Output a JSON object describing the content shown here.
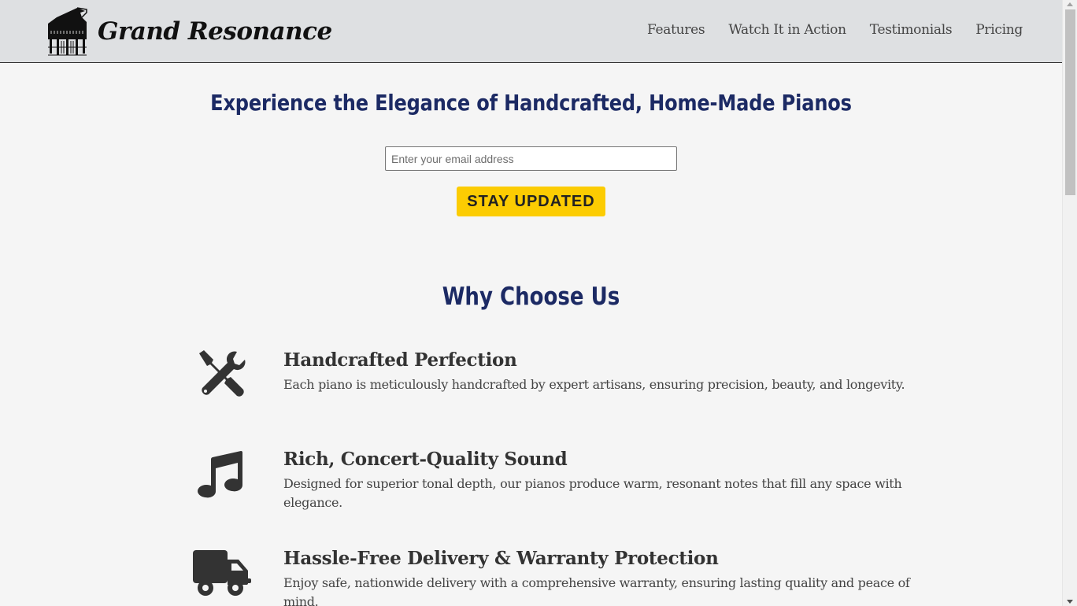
{
  "header": {
    "brand": "Grand Resonance",
    "nav": [
      {
        "label": "Features"
      },
      {
        "label": "Watch It in Action"
      },
      {
        "label": "Testimonials"
      },
      {
        "label": "Pricing"
      }
    ]
  },
  "hero": {
    "title": "Experience the Elegance of Handcrafted, Home-Made Pianos",
    "email_placeholder": "Enter your email address",
    "button_label": "STAY UPDATED"
  },
  "features": {
    "section_title": "Why Choose Us",
    "items": [
      {
        "icon": "tools-icon",
        "title": "Handcrafted Perfection",
        "desc": "Each piano is meticulously handcrafted by expert artisans, ensuring precision, beauty, and longevity."
      },
      {
        "icon": "music-note-icon",
        "title": "Rich, Concert-Quality Sound",
        "desc": "Designed for superior tonal depth, our pianos produce warm, resonant notes that fill any space with elegance."
      },
      {
        "icon": "truck-icon",
        "title": "Hassle-Free Delivery & Warranty Protection",
        "desc": "Enjoy safe, nationwide delivery with a comprehensive warranty, ensuring lasting quality and peace of mind."
      }
    ]
  },
  "colors": {
    "header_bg": "#dee0e2",
    "heading": "#1c2a64",
    "button": "#fccc02",
    "page_bg": "#f5f5f5"
  }
}
